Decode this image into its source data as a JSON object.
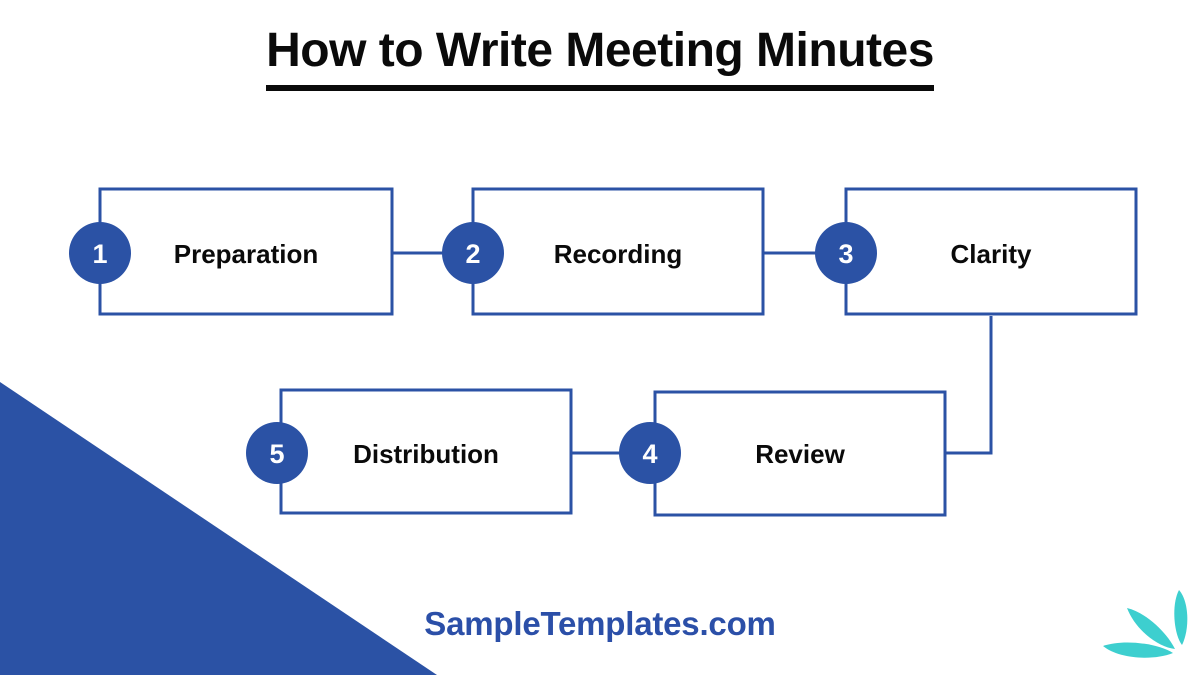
{
  "page": {
    "title": "How to Write Meeting Minutes",
    "background_color": "#ffffff",
    "accent_blue": "#2B52A5",
    "title_color": "#0a0a0a",
    "watermark_color": "#2B4FA8",
    "leaf_color": "#3DCFCF"
  },
  "flow": {
    "steps": [
      {
        "number": "1",
        "label": "Preparation"
      },
      {
        "number": "2",
        "label": "Recording"
      },
      {
        "number": "3",
        "label": "Clarity"
      },
      {
        "number": "4",
        "label": "Review"
      },
      {
        "number": "5",
        "label": "Distribution"
      }
    ]
  },
  "footer": {
    "watermark": "SampleTemplates.com"
  },
  "decorations": {
    "corner_triangle": "blue-triangle-bottom-left",
    "leaves": "teal-leaves-bottom-right"
  }
}
